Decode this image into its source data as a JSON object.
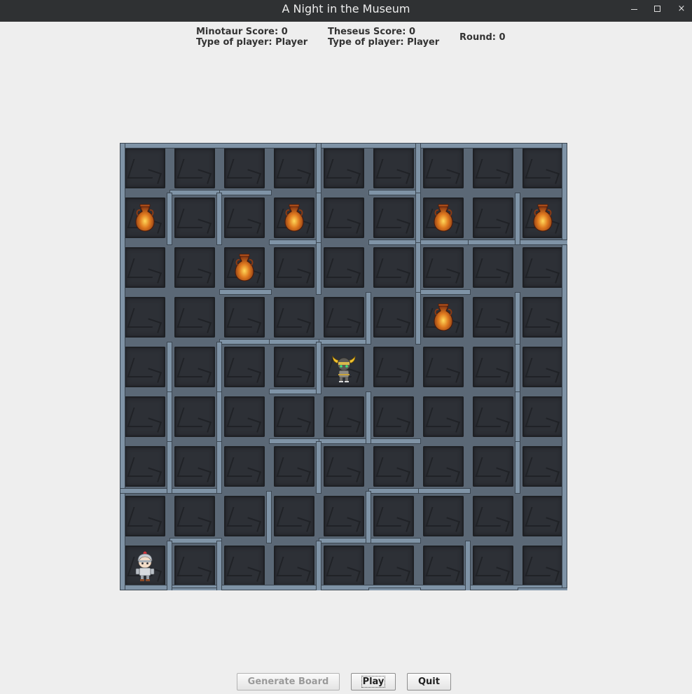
{
  "window": {
    "title": "A Night in the Museum",
    "controls": [
      "minimize",
      "maximize",
      "close"
    ],
    "close_glyph": "×"
  },
  "hud": {
    "minotaur_score": "Minotaur Score: 0",
    "minotaur_type": "Type of player: Player",
    "theseus_score": "Theseus Score: 0",
    "theseus_type": "Type of player: Player",
    "round": "Round: 0"
  },
  "board": {
    "rows": 9,
    "cols": 9,
    "theseus": {
      "row": 8,
      "col": 0,
      "icon": "theseus-icon"
    },
    "minotaur": {
      "row": 4,
      "col": 4,
      "icon": "minotaur-icon"
    },
    "vases": [
      {
        "row": 1,
        "col": 0
      },
      {
        "row": 1,
        "col": 3
      },
      {
        "row": 1,
        "col": 6
      },
      {
        "row": 1,
        "col": 8
      },
      {
        "row": 2,
        "col": 2
      },
      {
        "row": 3,
        "col": 6
      }
    ],
    "walls_h": [
      [
        0,
        1
      ],
      [
        0,
        2
      ],
      [
        1,
        3
      ],
      [
        1,
        5
      ],
      [
        1,
        6
      ],
      [
        1,
        7
      ],
      [
        1,
        8
      ],
      [
        2,
        2
      ],
      [
        3,
        2
      ],
      [
        3,
        3
      ],
      [
        3,
        4
      ],
      [
        4,
        3
      ],
      [
        5,
        3
      ],
      [
        5,
        4
      ],
      [
        5,
        5
      ],
      [
        6,
        5
      ],
      [
        6,
        6
      ],
      [
        7,
        1
      ],
      [
        7,
        4
      ],
      [
        7,
        5
      ],
      [
        8,
        1
      ],
      [
        8,
        5
      ],
      [
        8,
        8
      ],
      [
        2,
        6
      ],
      [
        0,
        5
      ],
      [
        6,
        0
      ],
      [
        6,
        1
      ]
    ],
    "walls_v": [
      [
        1,
        0
      ],
      [
        1,
        1
      ],
      [
        0,
        3
      ],
      [
        1,
        3
      ],
      [
        2,
        3
      ],
      [
        0,
        5
      ],
      [
        1,
        5
      ],
      [
        2,
        5
      ],
      [
        3,
        4
      ],
      [
        3,
        5
      ],
      [
        4,
        0
      ],
      [
        4,
        1
      ],
      [
        4,
        3
      ],
      [
        5,
        0
      ],
      [
        5,
        1
      ],
      [
        5,
        4
      ],
      [
        6,
        0
      ],
      [
        6,
        1
      ],
      [
        7,
        2
      ],
      [
        7,
        4
      ],
      [
        8,
        0
      ],
      [
        8,
        1
      ],
      [
        8,
        3
      ],
      [
        8,
        6
      ],
      [
        4,
        7
      ],
      [
        5,
        7
      ],
      [
        6,
        7
      ],
      [
        3,
        7
      ],
      [
        6,
        3
      ],
      [
        1,
        7
      ]
    ]
  },
  "buttons": {
    "generate": "Generate Board",
    "play": "Play",
    "quit": "Quit"
  }
}
